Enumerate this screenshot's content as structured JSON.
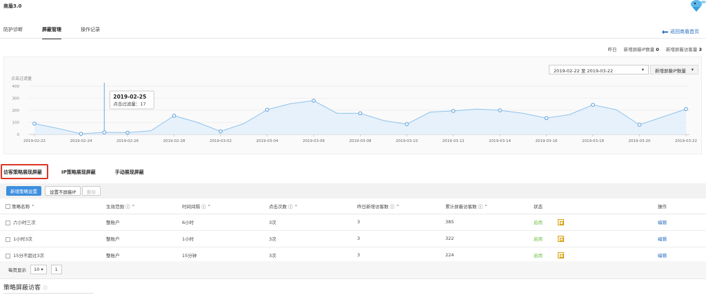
{
  "app": {
    "title": "商盾3.0"
  },
  "tabs": [
    {
      "label": "防护诊断"
    },
    {
      "label": "屏蔽管理"
    },
    {
      "label": "操作记录"
    }
  ],
  "back_link": "返回商盾首页",
  "summary": {
    "yesterday_label": "昨日",
    "ip_label": "新增屏蔽IP数量",
    "ip_value": "0",
    "visitor_label": "新增屏蔽访客量",
    "visitor_value": "3"
  },
  "filters": {
    "date_range": "2019-02-22 至 2019-03-22",
    "metric": "新增屏蔽IP数量"
  },
  "chart_data": {
    "type": "area",
    "ylabel": "点击过滤量",
    "ylim": [
      0,
      400
    ],
    "yticks": [
      "400",
      "300",
      "200",
      "100",
      "0"
    ],
    "x": [
      "2019-02-22",
      "2019-02-23",
      "2019-02-24",
      "2019-02-25",
      "2019-02-26",
      "2019-02-27",
      "2019-02-28",
      "2019-03-01",
      "2019-03-02",
      "2019-03-03",
      "2019-03-04",
      "2019-03-05",
      "2019-03-06",
      "2019-03-07",
      "2019-03-08",
      "2019-03-09",
      "2019-03-10",
      "2019-03-11",
      "2019-03-12",
      "2019-03-13",
      "2019-03-14",
      "2019-03-15",
      "2019-03-16",
      "2019-03-17",
      "2019-03-18",
      "2019-03-19",
      "2019-03-20",
      "2019-03-21",
      "2019-03-22"
    ],
    "xticks": [
      "2019-02-22",
      "2019-02-24",
      "2019-02-26",
      "2019-02-28",
      "2019-03-02",
      "2019-03-04",
      "2019-03-06",
      "2019-03-08",
      "2019-03-10",
      "2019-03-12",
      "2019-03-14",
      "2019-03-16",
      "2019-03-18",
      "2019-03-20",
      "2019-03-22"
    ],
    "values": [
      90,
      50,
      5,
      17,
      15,
      30,
      155,
      100,
      25,
      90,
      205,
      255,
      280,
      175,
      175,
      115,
      85,
      185,
      195,
      210,
      200,
      175,
      135,
      165,
      245,
      205,
      80,
      145,
      210
    ],
    "marked": [
      0,
      2,
      3,
      4,
      6,
      8,
      10,
      12,
      14,
      16,
      18,
      20,
      22,
      24,
      26,
      28
    ],
    "tooltip": {
      "date": "2019-02-25",
      "label": "点击过滤量：17"
    },
    "tooltip_index": 3,
    "line_color": "#90c2ec",
    "fill_color": "#e3f0fb"
  },
  "subtabs": [
    {
      "label": "访客策略展现屏蔽"
    },
    {
      "label": "IP策略展现屏蔽"
    },
    {
      "label": "手动展现屏蔽"
    }
  ],
  "toolbar": {
    "add": "新增策略设置",
    "exclude": "设置不屏蔽IP",
    "delete": "删除"
  },
  "table": {
    "headers": [
      "策略名称",
      "生效范围",
      "时间间隔",
      "点击次数",
      "昨日新增访客数",
      "累计屏蔽访客数",
      "状态",
      "操作"
    ],
    "rows": [
      {
        "name": "六小时三次",
        "scope": "整账户",
        "interval": "6小时",
        "clicks": "3次",
        "new": "3",
        "total": "385",
        "status": "启用",
        "op": "编辑"
      },
      {
        "name": "1小时3次",
        "scope": "整账户",
        "interval": "1小时",
        "clicks": "3次",
        "new": "3",
        "total": "322",
        "status": "启用",
        "op": "编辑"
      },
      {
        "name": "15分不超过3次",
        "scope": "整账户",
        "interval": "15分钟",
        "clicks": "3次",
        "new": "3",
        "total": "224",
        "status": "启用",
        "op": "编辑"
      }
    ]
  },
  "pager": {
    "per_page_label": "每页显示",
    "per_page": "10",
    "page": "1"
  },
  "section": {
    "title": "策略屏蔽访客"
  },
  "colors": {
    "accent": "#3d8fe0",
    "link": "#2b6fc1",
    "highlight": "#dd3322",
    "status_on": "#6cbf3f"
  }
}
